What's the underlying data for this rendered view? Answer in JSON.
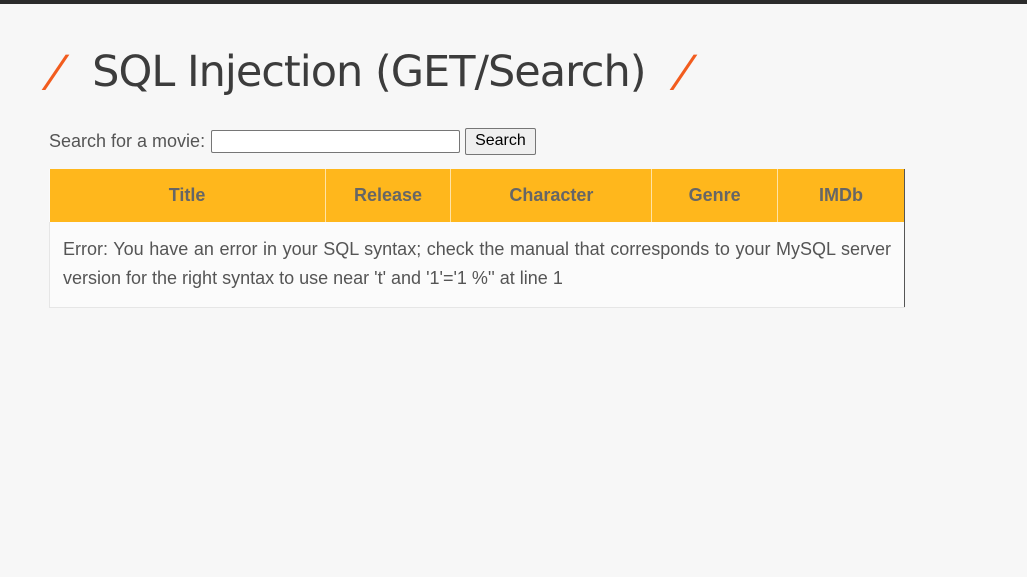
{
  "header": {
    "slash": "/",
    "title": "SQL Injection (GET/Search)"
  },
  "search": {
    "label": "Search for a movie:",
    "value": "",
    "placeholder": "",
    "button_label": "Search"
  },
  "table": {
    "columns": [
      "Title",
      "Release",
      "Character",
      "Genre",
      "IMDb"
    ],
    "error_message": "Error: You have an error in your SQL syntax; check the manual that corresponds to your MySQL server version for the right syntax to use near 't' and '1'='1 %'' at line 1"
  },
  "colors": {
    "accent": "#f25c1e",
    "table_header": "#ffb71c",
    "top_bar": "#2b2b2b"
  }
}
